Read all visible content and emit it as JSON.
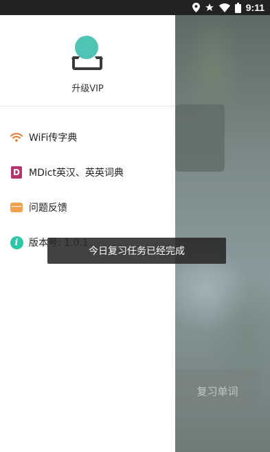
{
  "status_bar": {
    "time": "9:11",
    "icons": [
      "location-icon",
      "star-icon",
      "wifi-signal-icon",
      "battery-icon"
    ]
  },
  "drawer": {
    "upgrade_label": "升级VIP",
    "items": [
      {
        "label": "WiFi传字典",
        "icon": "wifi-icon",
        "icon_color": "#e07a2c"
      },
      {
        "label": "MDict英汉、英英词典",
        "icon": "dictionary-icon",
        "icon_color": "#b8326e",
        "icon_glyph": "D"
      },
      {
        "label": "问题反馈",
        "icon": "feedback-mail-icon",
        "icon_color": "#f0a04e"
      },
      {
        "label": "版本号: 1.0.1",
        "icon": "info-icon",
        "icon_color": "#2bc7a8",
        "icon_glyph": "i"
      }
    ]
  },
  "background": {
    "review_button_label": "复习单词"
  },
  "toast": {
    "message": "今日复习任务已经完成"
  }
}
